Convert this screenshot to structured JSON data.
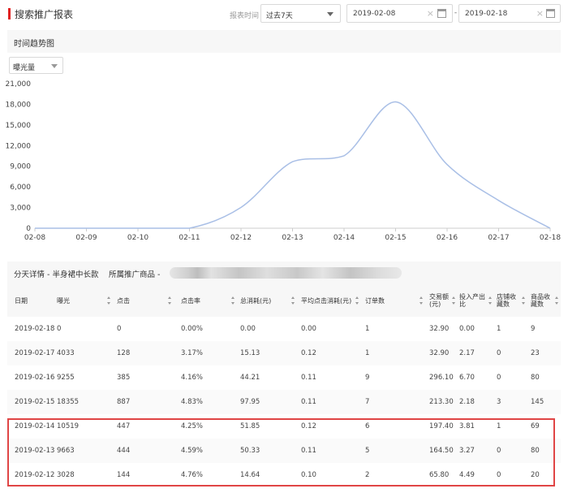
{
  "header": {
    "title": "搜索推广报表",
    "range_label": "报表时间",
    "range_value": "过去7天",
    "date_start": "2019-02-08",
    "date_sep": "-",
    "date_end": "2019-02-18",
    "clear_icon": "×"
  },
  "trend": {
    "title": "时间趋势图",
    "metric": "曝光量"
  },
  "chart_data": {
    "type": "line",
    "x": [
      "02-08",
      "02-09",
      "02-10",
      "02-11",
      "02-12",
      "02-13",
      "02-14",
      "02-15",
      "02-16",
      "02-17",
      "02-18"
    ],
    "series": [
      {
        "values": [
          0,
          0,
          0,
          0,
          3028,
          9663,
          10519,
          18355,
          9255,
          4033,
          0
        ]
      }
    ],
    "y_ticks": [
      "0",
      "3,000",
      "6,000",
      "9,000",
      "12,000",
      "15,000",
      "18,000",
      "21,000"
    ],
    "ylim": [
      0,
      21000
    ],
    "line_color": "#a9bfe6",
    "grid": false
  },
  "detail": {
    "label": "分天详情 - 半身裙中长款",
    "product_label": "所属推广商品 -"
  },
  "table": {
    "columns": [
      "日期",
      "曝光",
      "点击",
      "点击率",
      "总消耗(元)",
      "平均点击消耗(元)",
      "订单数",
      "交易额(元)",
      "投入产出比",
      "店铺收藏数",
      "商品收藏数"
    ],
    "rows": [
      [
        "2019-02-18",
        "0",
        "0",
        "0.00%",
        "0.00",
        "0.00",
        "1",
        "32.90",
        "0.00",
        "1",
        "9"
      ],
      [
        "2019-02-17",
        "4033",
        "128",
        "3.17%",
        "15.13",
        "0.12",
        "1",
        "32.90",
        "2.17",
        "0",
        "23"
      ],
      [
        "2019-02-16",
        "9255",
        "385",
        "4.16%",
        "44.21",
        "0.11",
        "9",
        "296.10",
        "6.70",
        "0",
        "80"
      ],
      [
        "2019-02-15",
        "18355",
        "887",
        "4.83%",
        "97.95",
        "0.11",
        "7",
        "213.30",
        "2.18",
        "3",
        "145"
      ],
      [
        "2019-02-14",
        "10519",
        "447",
        "4.25%",
        "51.85",
        "0.12",
        "6",
        "197.40",
        "3.81",
        "1",
        "69"
      ],
      [
        "2019-02-13",
        "9663",
        "444",
        "4.59%",
        "50.33",
        "0.11",
        "5",
        "164.50",
        "3.27",
        "0",
        "80"
      ],
      [
        "2019-02-12",
        "3028",
        "144",
        "4.76%",
        "14.64",
        "0.10",
        "2",
        "65.80",
        "4.49",
        "0",
        "20"
      ]
    ]
  }
}
